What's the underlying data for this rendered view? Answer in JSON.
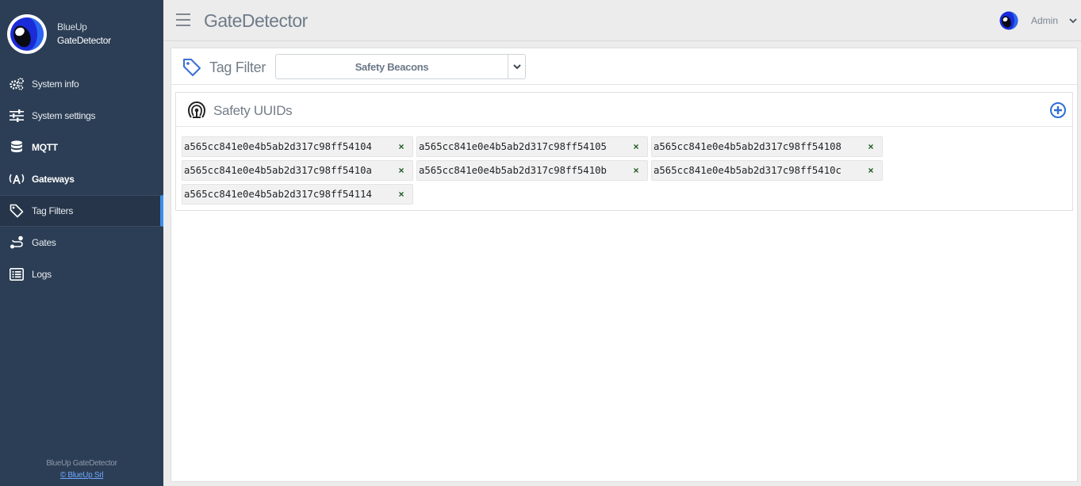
{
  "brand": {
    "line1": "BlueUp",
    "line2": "GateDetector"
  },
  "sidebar": {
    "items": [
      {
        "label": "System info",
        "icon": "gears-icon",
        "bold": false
      },
      {
        "label": "System settings",
        "icon": "sliders-icon",
        "bold": false
      },
      {
        "label": "MQTT",
        "icon": "database-icon",
        "bold": true
      },
      {
        "label": "Gateways",
        "icon": "broadcast-icon",
        "bold": true
      },
      {
        "label": "Tag Filters",
        "icon": "tag-icon",
        "bold": false,
        "active": true
      },
      {
        "label": "Gates",
        "icon": "route-icon",
        "bold": false
      },
      {
        "label": "Logs",
        "icon": "list-icon",
        "bold": false
      }
    ],
    "footer": {
      "line1": "BlueUp GateDetector",
      "link": "© BlueUp Srl"
    }
  },
  "header": {
    "title": "GateDetector",
    "user": "Admin"
  },
  "filter": {
    "label": "Tag Filter",
    "selected": "Safety Beacons"
  },
  "card": {
    "title": "Safety UUIDs",
    "uuids": [
      "a565cc841e0e4b5ab2d317c98ff54104",
      "a565cc841e0e4b5ab2d317c98ff54105",
      "a565cc841e0e4b5ab2d317c98ff54108",
      "a565cc841e0e4b5ab2d317c98ff5410a",
      "a565cc841e0e4b5ab2d317c98ff5410b",
      "a565cc841e0e4b5ab2d317c98ff5410c",
      "a565cc841e0e4b5ab2d317c98ff54114"
    ],
    "remove_symbol": "×"
  },
  "colors": {
    "sidebar": "#2c3e55",
    "accent": "#3d8ee8",
    "add_icon": "#2d6fd6",
    "remove_icon": "#1e5a1e"
  }
}
